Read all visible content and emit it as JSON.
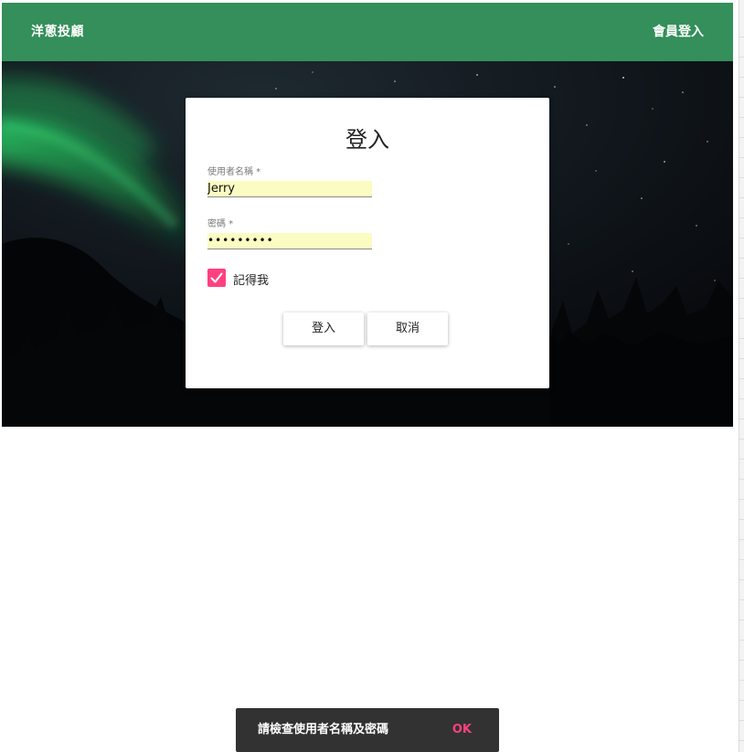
{
  "appbar": {
    "brand": "洋蔥投顧",
    "login_link": "會員登入",
    "color": "#348f5a"
  },
  "login_dialog": {
    "title": "登入",
    "username": {
      "label": "使用者名稱 *",
      "value": "Jerry"
    },
    "password": {
      "label": "密碼 *",
      "value": "•••••••••"
    },
    "remember_me": {
      "label": "記得我",
      "checked": true,
      "color": "#ff4081"
    },
    "buttons": {
      "login": "登入",
      "cancel": "取消"
    }
  },
  "snackbar": {
    "message": "請檢查使用者名稱及密碼",
    "action": "OK",
    "action_color": "#ff4081"
  },
  "icons": {
    "checkbox": "check-icon"
  }
}
